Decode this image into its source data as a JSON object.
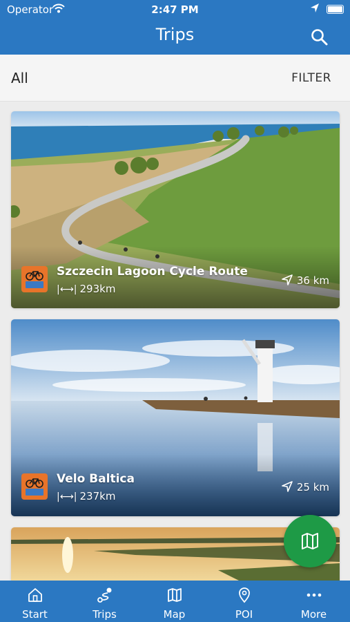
{
  "status_bar": {
    "carrier": "Operator",
    "time": "2:47 PM"
  },
  "nav": {
    "title": "Trips",
    "search_icon": "search-icon"
  },
  "filter_bar": {
    "selected": "All",
    "filter_label": "FILTER"
  },
  "trips": [
    {
      "name": "Szczecin Lagoon Cycle Route",
      "length": "293km",
      "distance": "36 km",
      "type_icon": "bicycle-icon"
    },
    {
      "name": "Velo Baltica",
      "length": "237km",
      "distance": "25 km",
      "type_icon": "bicycle-icon"
    }
  ],
  "fab": {
    "icon": "map-icon"
  },
  "tabs": [
    {
      "label": "Start",
      "icon": "home-icon"
    },
    {
      "label": "Trips",
      "icon": "route-icon"
    },
    {
      "label": "Map",
      "icon": "map-icon"
    },
    {
      "label": "POI",
      "icon": "location-pin-icon"
    },
    {
      "label": "More",
      "icon": "more-dots-icon"
    }
  ],
  "colors": {
    "primary": "#2b78c2",
    "fab": "#1e9a46",
    "trip_badge": "#e8742a"
  }
}
